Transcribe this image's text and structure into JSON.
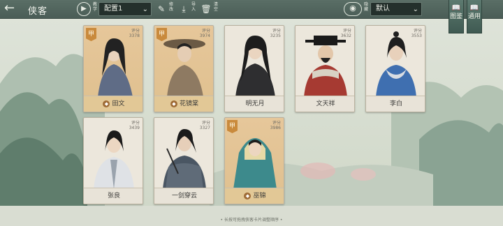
{
  "header": {
    "back_icon": "←",
    "title": "侠客",
    "play_icon": "▶",
    "play_caption": "教学",
    "preset_select": "配置1",
    "edit_caption": "修改",
    "import_caption": "导入",
    "clear_caption": "清空",
    "view_caption": "隐藏",
    "sort_select": "默认"
  },
  "side_tabs": [
    {
      "label": "图鉴",
      "icon": "📖"
    },
    {
      "label": "通用",
      "icon": "📖"
    }
  ],
  "heroes": [
    {
      "name": "田文",
      "badge": "甲",
      "power_label": "评分",
      "power": "3378",
      "gold": true,
      "icon": true
    },
    {
      "name": "花镜棠",
      "badge": "甲",
      "power_label": "评分",
      "power": "3974",
      "gold": true,
      "icon": true
    },
    {
      "name": "明无月",
      "badge": "",
      "power_label": "评分",
      "power": "3235",
      "gold": false,
      "icon": false
    },
    {
      "name": "文天祥",
      "badge": "",
      "power_label": "评分",
      "power": "3632",
      "gold": false,
      "icon": false
    },
    {
      "name": "李白",
      "badge": "",
      "power_label": "评分",
      "power": "3553",
      "gold": false,
      "icon": false
    },
    {
      "name": "张良",
      "badge": "",
      "power_label": "评分",
      "power": "3439",
      "gold": false,
      "icon": false
    },
    {
      "name": "一剑穿云",
      "badge": "",
      "power_label": "评分",
      "power": "3327",
      "gold": false,
      "icon": false
    },
    {
      "name": "巫锦",
      "badge": "甲",
      "power_label": "评分",
      "power": "3986",
      "gold": true,
      "icon": true
    }
  ],
  "hint": "• 长按可拖拽侠客卡片调整顺序 •",
  "colors": {
    "header": "#4f635c",
    "gold": "#dfc08f",
    "badge": "#c98a3c"
  }
}
